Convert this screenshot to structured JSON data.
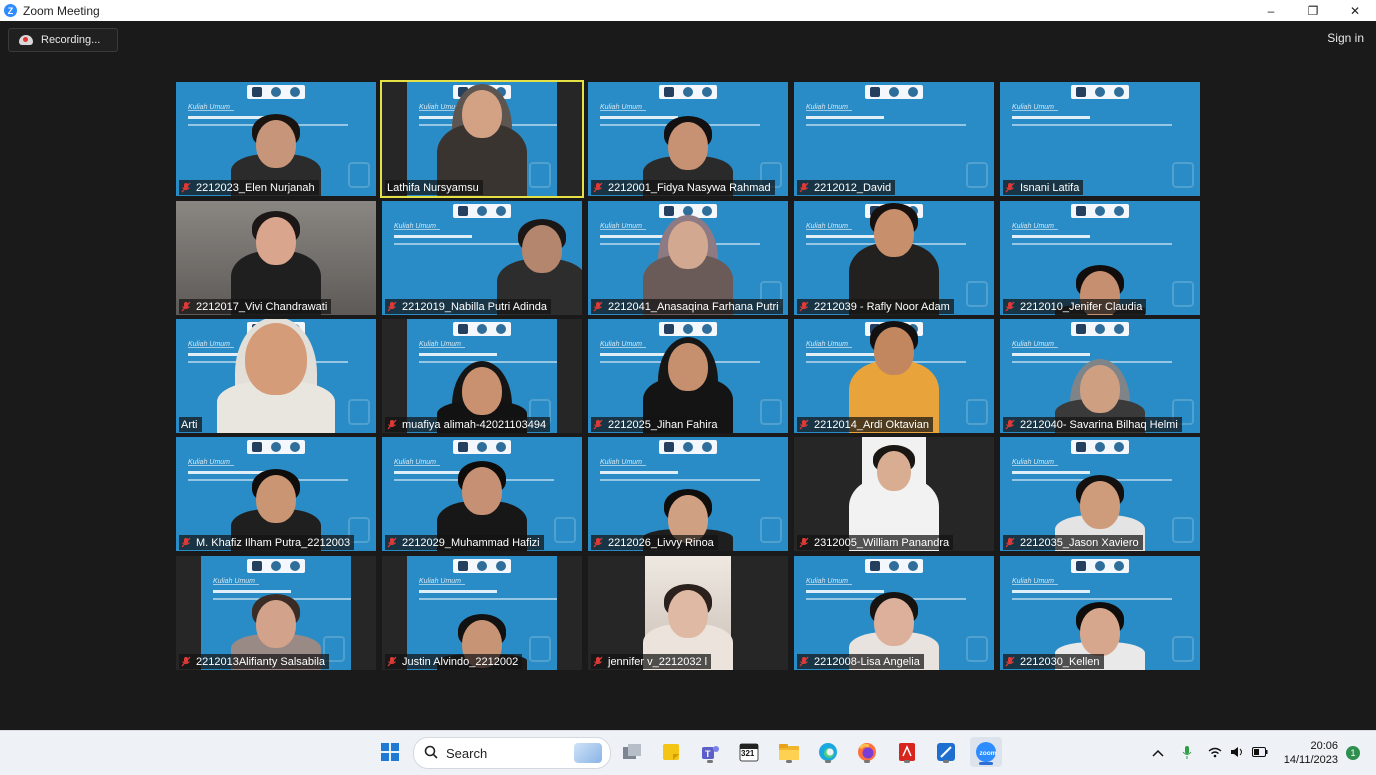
{
  "window": {
    "title": "Zoom Meeting",
    "controls": {
      "minimize": "–",
      "maximize": "❐",
      "close": "✕"
    }
  },
  "toolbar": {
    "recording_label": "Recording...",
    "sign_in_label": "Sign in"
  },
  "slide_text": {
    "kuliah_umum": "Kuliah Umum"
  },
  "participants": [
    {
      "name": "2212023_Elen Nurjanah",
      "muted": true
    },
    {
      "name": "Lathifa Nursyamsu",
      "muted": false,
      "active_speaker": true
    },
    {
      "name": "2212001_Fidya Nasywa Rahmad",
      "muted": true
    },
    {
      "name": "2212012_David",
      "muted": true
    },
    {
      "name": "Isnani Latifa",
      "muted": true
    },
    {
      "name": "2212017_Vivi Chandrawati",
      "muted": true
    },
    {
      "name": "2212019_Nabilla Putri Adinda",
      "muted": true
    },
    {
      "name": "2212041_Anasaqina Farhana Putri",
      "muted": true
    },
    {
      "name": "2212039 - Rafly Noor Adam",
      "muted": true
    },
    {
      "name": "2212010_Jenifer Claudia",
      "muted": true
    },
    {
      "name": "Arti",
      "muted": false
    },
    {
      "name": "muafiya alimah-42021103494",
      "muted": true
    },
    {
      "name": "2212025_Jihan Fahira",
      "muted": true
    },
    {
      "name": "2212014_Ardi Oktavian",
      "muted": true
    },
    {
      "name": "2212040- Savarina Bilhaq Helmi",
      "muted": true
    },
    {
      "name": "M. Khafiz Ilham Putra_2212003",
      "muted": true
    },
    {
      "name": "2212029_Muhammad Hafizi",
      "muted": true
    },
    {
      "name": "2212026_Livvy Rinoa",
      "muted": true
    },
    {
      "name": "2312005_William Panandra",
      "muted": true
    },
    {
      "name": "2212035_Jason Xaviero",
      "muted": true
    },
    {
      "name": "2212013Alifianty Salsabila",
      "muted": true
    },
    {
      "name": "Justin Alvindo_2212002",
      "muted": true
    },
    {
      "name": "jennifer v_2212032 l",
      "muted": true
    },
    {
      "name": "2212008-Lisa Angelia",
      "muted": true
    },
    {
      "name": "2212030_Kellen",
      "muted": true
    }
  ],
  "taskbar": {
    "search_label": "Search",
    "time": "20:06",
    "date": "14/11/2023",
    "notification_count": "1",
    "calendar_day": "321",
    "icons": [
      "windows-start-icon",
      "search-icon",
      "task-view-icon",
      "sticky-notes-icon",
      "teams-icon",
      "calendar-icon",
      "file-explorer-icon",
      "edge-icon",
      "firefox-icon",
      "acrobat-icon",
      "snipping-tool-icon",
      "zoom-icon"
    ],
    "tray_icons": [
      "chevron-up-icon",
      "microphone-icon",
      "wifi-icon",
      "volume-icon",
      "battery-icon"
    ]
  },
  "colors": {
    "active_speaker": "#e5e044",
    "slide_bg": "#2a8cc6",
    "muted_icon": "#e03a36",
    "background": "#1a1a1a"
  }
}
